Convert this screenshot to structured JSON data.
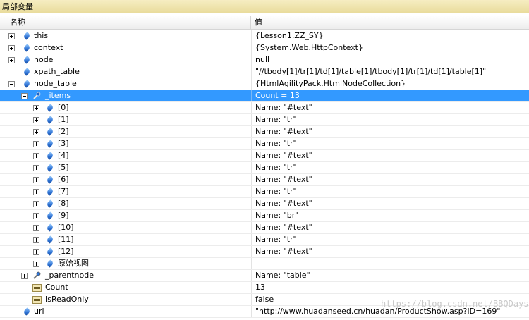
{
  "panel": {
    "title": "局部变量"
  },
  "columns": {
    "name": "名称",
    "value": "值"
  },
  "rows": [
    {
      "name": "this",
      "value": "{Lesson1.ZZ_SY}"
    },
    {
      "name": "context",
      "value": "{System.Web.HttpContext}"
    },
    {
      "name": "node",
      "value": "null"
    },
    {
      "name": "xpath_table",
      "value": "\"//tbody[1]/tr[1]/td[1]/table[1]/tbody[1]/tr[1]/td[1]/table[1]\""
    },
    {
      "name": "node_table",
      "value": "{HtmlAgilityPack.HtmlNodeCollection}"
    },
    {
      "name": "_items",
      "value": "Count = 13"
    },
    {
      "name": "[0]",
      "value": "Name: \"#text\""
    },
    {
      "name": "[1]",
      "value": "Name: \"tr\""
    },
    {
      "name": "[2]",
      "value": "Name: \"#text\""
    },
    {
      "name": "[3]",
      "value": "Name: \"tr\""
    },
    {
      "name": "[4]",
      "value": "Name: \"#text\""
    },
    {
      "name": "[5]",
      "value": "Name: \"tr\""
    },
    {
      "name": "[6]",
      "value": "Name: \"#text\""
    },
    {
      "name": "[7]",
      "value": "Name: \"tr\""
    },
    {
      "name": "[8]",
      "value": "Name: \"#text\""
    },
    {
      "name": "[9]",
      "value": "Name: \"br\""
    },
    {
      "name": "[10]",
      "value": "Name: \"#text\""
    },
    {
      "name": "[11]",
      "value": "Name: \"tr\""
    },
    {
      "name": "[12]",
      "value": "Name: \"#text\""
    },
    {
      "name": "原始视图",
      "value": ""
    },
    {
      "name": "_parentnode",
      "value": "Name: \"table\""
    },
    {
      "name": "Count",
      "value": "13"
    },
    {
      "name": "IsReadOnly",
      "value": "false"
    },
    {
      "name": "url",
      "value": "\"http://www.huadanseed.cn/huadan/ProductShow.asp?ID=169\""
    }
  ],
  "icons": {
    "field": "field-icon",
    "wrench": "wrench-icon",
    "property": "property-icon",
    "expand": "expand-plus-icon",
    "collapse": "collapse-minus-icon"
  },
  "colors": {
    "selection": "#3399ff",
    "panel_title": "#efe3aa"
  },
  "watermark": "https://blog.csdn.net/BBQDays"
}
